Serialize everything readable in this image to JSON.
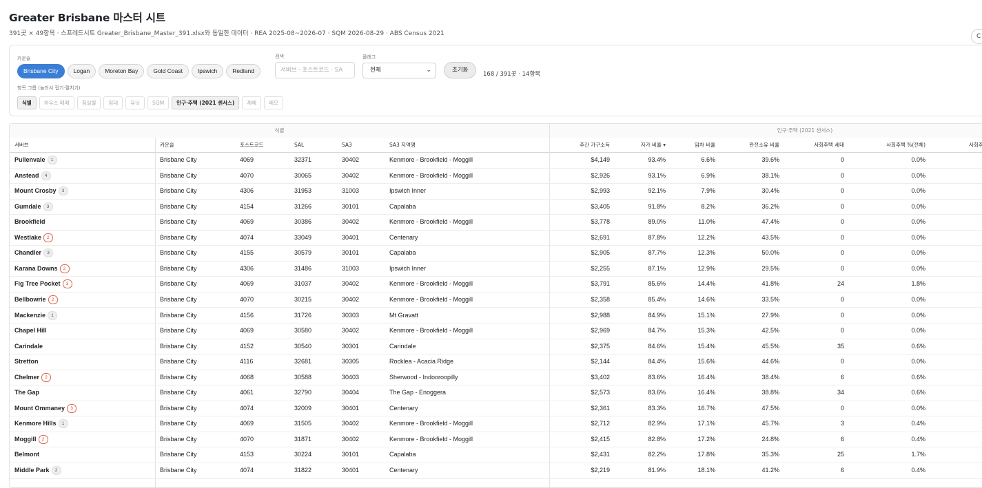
{
  "page": {
    "title": "Greater Brisbane 마스터 시트",
    "subtitle": "391곳 × 49항목 · 스프레드시트 Greater_Brisbane_Master_391.xlsx와 동일한 데이터 · REA 2025-08~2026-07 · SQM 2026-08-29 · ABS Census 2021",
    "side_button_label": "C"
  },
  "filters": {
    "council_label": "카운슬",
    "councils": [
      {
        "label": "Brisbane City",
        "active": true
      },
      {
        "label": "Logan",
        "active": false
      },
      {
        "label": "Moreton Bay",
        "active": false
      },
      {
        "label": "Gold Coast",
        "active": false
      },
      {
        "label": "Ipswich",
        "active": false
      },
      {
        "label": "Redland",
        "active": false
      }
    ],
    "search_label": "검색",
    "search_placeholder": "서버브 · 포스트코드 · SA",
    "flag_label": "플래그",
    "flag_value": "전체",
    "reset_label": "초기화",
    "count_text": "168 / 391곳 · 14항목",
    "groups_label": "항목 그룹 (눌러서 접기·펼치기)",
    "groups": [
      {
        "label": "식별",
        "on": true
      },
      {
        "label": "하우스 매매",
        "on": false
      },
      {
        "label": "침실별",
        "on": false
      },
      {
        "label": "임대",
        "on": false
      },
      {
        "label": "유닛",
        "on": false
      },
      {
        "label": "SQM",
        "on": false
      },
      {
        "label": "인구·주택 (2021 센서스)",
        "on": true
      },
      {
        "label": "재해",
        "on": false
      },
      {
        "label": "메모",
        "on": false
      }
    ]
  },
  "table": {
    "group_headers": [
      "식별",
      "인구·주택 (2021 센서스)"
    ],
    "columns": [
      "서버브",
      "카운슬",
      "포스트코드",
      "SAL",
      "SA3",
      "SA3 지역명",
      "주간 가구소득",
      "자가 비율 ▾",
      "임차 비율",
      "완전소유 비율",
      "사회주택 세대",
      "사회주택 %(전체)",
      "사회주"
    ],
    "rows": [
      {
        "suburb": "Pullenvale",
        "badge": "1",
        "warn": false,
        "council": "Brisbane City",
        "postcode": "4069",
        "sal": "32371",
        "sa3": "30402",
        "sa3_name": "Kenmore - Brookfield - Moggill",
        "income": "$4,149",
        "owner": "93.4%",
        "renter": "6.6%",
        "outright": "39.6%",
        "social_hh": "0",
        "social_pct": "0.0%"
      },
      {
        "suburb": "Anstead",
        "badge": "4",
        "warn": false,
        "council": "Brisbane City",
        "postcode": "4070",
        "sal": "30065",
        "sa3": "30402",
        "sa3_name": "Kenmore - Brookfield - Moggill",
        "income": "$2,926",
        "owner": "93.1%",
        "renter": "6.9%",
        "outright": "38.1%",
        "social_hh": "0",
        "social_pct": "0.0%"
      },
      {
        "suburb": "Mount Crosby",
        "badge": "3",
        "warn": false,
        "council": "Brisbane City",
        "postcode": "4306",
        "sal": "31953",
        "sa3": "31003",
        "sa3_name": "Ipswich Inner",
        "income": "$2,993",
        "owner": "92.1%",
        "renter": "7.9%",
        "outright": "30.4%",
        "social_hh": "0",
        "social_pct": "0.0%"
      },
      {
        "suburb": "Gumdale",
        "badge": "3",
        "warn": false,
        "council": "Brisbane City",
        "postcode": "4154",
        "sal": "31266",
        "sa3": "30101",
        "sa3_name": "Capalaba",
        "income": "$3,405",
        "owner": "91.8%",
        "renter": "8.2%",
        "outright": "36.2%",
        "social_hh": "0",
        "social_pct": "0.0%"
      },
      {
        "suburb": "Brookfield",
        "badge": "",
        "warn": false,
        "council": "Brisbane City",
        "postcode": "4069",
        "sal": "30386",
        "sa3": "30402",
        "sa3_name": "Kenmore - Brookfield - Moggill",
        "income": "$3,778",
        "owner": "89.0%",
        "renter": "11.0%",
        "outright": "47.4%",
        "social_hh": "0",
        "social_pct": "0.0%"
      },
      {
        "suburb": "Westlake",
        "badge": "2",
        "warn": true,
        "council": "Brisbane City",
        "postcode": "4074",
        "sal": "33049",
        "sa3": "30401",
        "sa3_name": "Centenary",
        "income": "$2,691",
        "owner": "87.8%",
        "renter": "12.2%",
        "outright": "43.5%",
        "social_hh": "0",
        "social_pct": "0.0%"
      },
      {
        "suburb": "Chandler",
        "badge": "3",
        "warn": false,
        "council": "Brisbane City",
        "postcode": "4155",
        "sal": "30579",
        "sa3": "30101",
        "sa3_name": "Capalaba",
        "income": "$2,905",
        "owner": "87.7%",
        "renter": "12.3%",
        "outright": "50.0%",
        "social_hh": "0",
        "social_pct": "0.0%"
      },
      {
        "suburb": "Karana Downs",
        "badge": "2",
        "warn": true,
        "council": "Brisbane City",
        "postcode": "4306",
        "sal": "31486",
        "sa3": "31003",
        "sa3_name": "Ipswich Inner",
        "income": "$2,255",
        "owner": "87.1%",
        "renter": "12.9%",
        "outright": "29.5%",
        "social_hh": "0",
        "social_pct": "0.0%"
      },
      {
        "suburb": "Fig Tree Pocket",
        "badge": "3",
        "warn": true,
        "council": "Brisbane City",
        "postcode": "4069",
        "sal": "31037",
        "sa3": "30402",
        "sa3_name": "Kenmore - Brookfield - Moggill",
        "income": "$3,791",
        "owner": "85.6%",
        "renter": "14.4%",
        "outright": "41.8%",
        "social_hh": "24",
        "social_pct": "1.8%"
      },
      {
        "suburb": "Bellbowrie",
        "badge": "2",
        "warn": true,
        "council": "Brisbane City",
        "postcode": "4070",
        "sal": "30215",
        "sa3": "30402",
        "sa3_name": "Kenmore - Brookfield - Moggill",
        "income": "$2,358",
        "owner": "85.4%",
        "renter": "14.6%",
        "outright": "33.5%",
        "social_hh": "0",
        "social_pct": "0.0%"
      },
      {
        "suburb": "Mackenzie",
        "badge": "1",
        "warn": false,
        "council": "Brisbane City",
        "postcode": "4156",
        "sal": "31726",
        "sa3": "30303",
        "sa3_name": "Mt Gravatt",
        "income": "$2,988",
        "owner": "84.9%",
        "renter": "15.1%",
        "outright": "27.9%",
        "social_hh": "0",
        "social_pct": "0.0%"
      },
      {
        "suburb": "Chapel Hill",
        "badge": "",
        "warn": false,
        "council": "Brisbane City",
        "postcode": "4069",
        "sal": "30580",
        "sa3": "30402",
        "sa3_name": "Kenmore - Brookfield - Moggill",
        "income": "$2,969",
        "owner": "84.7%",
        "renter": "15.3%",
        "outright": "42.5%",
        "social_hh": "0",
        "social_pct": "0.0%"
      },
      {
        "suburb": "Carindale",
        "badge": "",
        "warn": false,
        "council": "Brisbane City",
        "postcode": "4152",
        "sal": "30540",
        "sa3": "30301",
        "sa3_name": "Carindale",
        "income": "$2,375",
        "owner": "84.6%",
        "renter": "15.4%",
        "outright": "45.5%",
        "social_hh": "35",
        "social_pct": "0.6%"
      },
      {
        "suburb": "Stretton",
        "badge": "",
        "warn": false,
        "council": "Brisbane City",
        "postcode": "4116",
        "sal": "32681",
        "sa3": "30305",
        "sa3_name": "Rocklea - Acacia Ridge",
        "income": "$2,144",
        "owner": "84.4%",
        "renter": "15.6%",
        "outright": "44.6%",
        "social_hh": "0",
        "social_pct": "0.0%"
      },
      {
        "suburb": "Chelmer",
        "badge": "2",
        "warn": true,
        "council": "Brisbane City",
        "postcode": "4068",
        "sal": "30588",
        "sa3": "30403",
        "sa3_name": "Sherwood - Indooroopilly",
        "income": "$3,402",
        "owner": "83.6%",
        "renter": "16.4%",
        "outright": "38.4%",
        "social_hh": "6",
        "social_pct": "0.6%"
      },
      {
        "suburb": "The Gap",
        "badge": "",
        "warn": false,
        "council": "Brisbane City",
        "postcode": "4061",
        "sal": "32790",
        "sa3": "30404",
        "sa3_name": "The Gap - Enoggera",
        "income": "$2,573",
        "owner": "83.6%",
        "renter": "16.4%",
        "outright": "38.8%",
        "social_hh": "34",
        "social_pct": "0.6%"
      },
      {
        "suburb": "Mount Ommaney",
        "badge": "3",
        "warn": true,
        "council": "Brisbane City",
        "postcode": "4074",
        "sal": "32009",
        "sa3": "30401",
        "sa3_name": "Centenary",
        "income": "$2,361",
        "owner": "83.3%",
        "renter": "16.7%",
        "outright": "47.5%",
        "social_hh": "0",
        "social_pct": "0.0%"
      },
      {
        "suburb": "Kenmore Hills",
        "badge": "1",
        "warn": false,
        "council": "Brisbane City",
        "postcode": "4069",
        "sal": "31505",
        "sa3": "30402",
        "sa3_name": "Kenmore - Brookfield - Moggill",
        "income": "$2,712",
        "owner": "82.9%",
        "renter": "17.1%",
        "outright": "45.7%",
        "social_hh": "3",
        "social_pct": "0.4%"
      },
      {
        "suburb": "Moggill",
        "badge": "2",
        "warn": true,
        "council": "Brisbane City",
        "postcode": "4070",
        "sal": "31871",
        "sa3": "30402",
        "sa3_name": "Kenmore - Brookfield - Moggill",
        "income": "$2,415",
        "owner": "82.8%",
        "renter": "17.2%",
        "outright": "24.8%",
        "social_hh": "6",
        "social_pct": "0.4%"
      },
      {
        "suburb": "Belmont",
        "badge": "",
        "warn": false,
        "council": "Brisbane City",
        "postcode": "4153",
        "sal": "30224",
        "sa3": "30101",
        "sa3_name": "Capalaba",
        "income": "$2,431",
        "owner": "82.2%",
        "renter": "17.8%",
        "outright": "35.3%",
        "social_hh": "25",
        "social_pct": "1.7%"
      },
      {
        "suburb": "Middle Park",
        "badge": "2",
        "warn": false,
        "council": "Brisbane City",
        "postcode": "4074",
        "sal": "31822",
        "sa3": "30401",
        "sa3_name": "Centenary",
        "income": "$2,219",
        "owner": "81.9%",
        "renter": "18.1%",
        "outright": "41.2%",
        "social_hh": "6",
        "social_pct": "0.4%"
      }
    ]
  }
}
